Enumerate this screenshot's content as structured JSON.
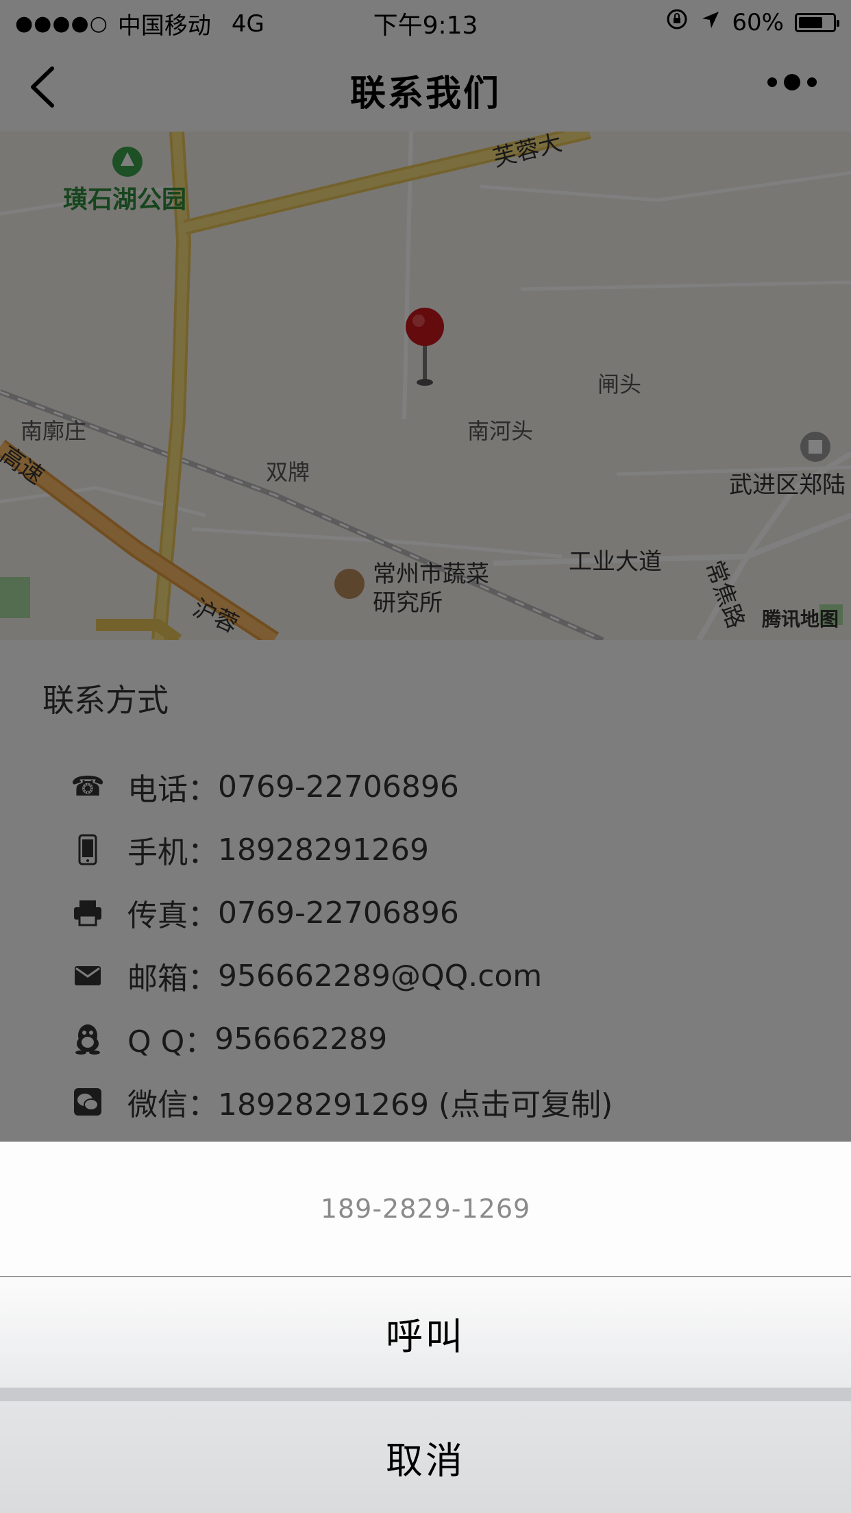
{
  "status_bar": {
    "signal": "●●●●○",
    "carrier": "中国移动",
    "network": "4G",
    "time": "下午9:13",
    "battery": "60%"
  },
  "nav": {
    "title": "联系我们"
  },
  "map": {
    "labels": {
      "park": "璜石湖公园",
      "furong": "芙蓉大",
      "zhatou": "闸头",
      "nanlizhuang": "南廓庄",
      "nanhetou": "南河头",
      "shuangpai": "双牌",
      "wujin": "武进区郑陆",
      "vegetable_line1": "常州市蔬菜",
      "vegetable_line2": "研究所",
      "gongye": "工业大道",
      "huning": "沪蓉",
      "gaosu": "高速",
      "changjiao": "常焦路",
      "logo": "腾讯地图"
    }
  },
  "contact": {
    "heading": "联系方式",
    "rows": [
      {
        "icon": "phone-icon",
        "label": "电话：",
        "value": "0769-22706896"
      },
      {
        "icon": "mobile-icon",
        "label": "手机：",
        "value": "18928291269"
      },
      {
        "icon": "fax-icon",
        "label": "传真：",
        "value": "0769-22706896"
      },
      {
        "icon": "mail-icon",
        "label": "邮箱：",
        "value": "956662289@QQ.com"
      },
      {
        "icon": "qq-icon",
        "label": "Q Q：",
        "value": "956662289"
      },
      {
        "icon": "wechat-icon",
        "label": "微信：",
        "value": "18928291269 (点击可复制)"
      }
    ]
  },
  "action_sheet": {
    "title": "189-2829-1269",
    "call_label": "呼叫",
    "cancel_label": "取消"
  },
  "colors": {
    "overlay": "rgba(0,0,0,0.5)",
    "pin": "#c8161d",
    "road_main": "#f5d36b",
    "road_highway": "#f0a64b"
  }
}
